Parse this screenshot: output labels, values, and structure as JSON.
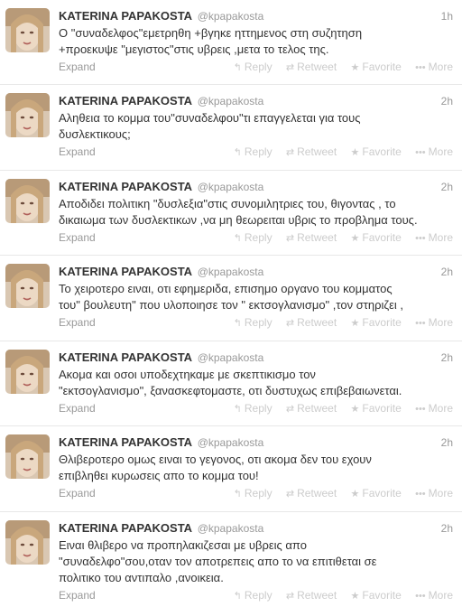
{
  "colors": {
    "name": "#333333",
    "muted": "#999999",
    "action": "#cccccc",
    "divider": "#e8e8e8"
  },
  "tweets": [
    {
      "fullname": "KATERINA PAPAKOSTA",
      "username": "@kpapakosta",
      "time": "1h",
      "lines": [
        "Ο  \"συναδελφος\"εμετρηθη +βγηκε ηττημενος στη συζητηση",
        "+προεκυψε \"μεγιστος\"στις  υβρεις ,μετα το τελος της."
      ],
      "expand": "Expand"
    },
    {
      "fullname": "KATERINA PAPAKOSTA",
      "username": "@kpapakosta",
      "time": "2h",
      "lines": [
        "Αληθεια το κομμα του\"συναδελφου\"τι επαγγελεται για τους",
        "δυσλεκτικους;"
      ],
      "expand": "Expand"
    },
    {
      "fullname": "KATERINA PAPAKOSTA",
      "username": "@kpapakosta",
      "time": "2h",
      "lines": [
        "Αποδιδει πολιτικη \"δυσλεξια\"στις συνομιλητριες  του, θιγοντας  , το",
        "δικαιωμα των δυσλεκτικων ,να μη θεωρειται υβρις το προβλημα  τους."
      ],
      "expand": "Expand"
    },
    {
      "fullname": "KATERINA PAPAKOSTA",
      "username": "@kpapakosta",
      "time": "2h",
      "lines": [
        "Το χειροτερο ειναι, οτι εφημεριδα,    επισημο οργανο του κομματος",
        "του\" βουλευτη\" που υλοποιησε  τον   \"   εκτσογλανισμο\" ,τον στηριζει ,"
      ],
      "expand": "Expand"
    },
    {
      "fullname": "KATERINA PAPAKOSTA",
      "username": "@kpapakosta",
      "time": "2h",
      "lines": [
        "Ακομα και οσοι υποδεχτηκαμε με  σκεπτικισμο  τον",
        "\"εκτσογλανισμο\", ξανασκεφτομαστε, οτι δυστυχως επιβεβαιωνεται."
      ],
      "expand": "Expand"
    },
    {
      "fullname": "KATERINA PAPAKOSTA",
      "username": "@kpapakosta",
      "time": "2h",
      "lines": [
        "Θλιβεροτερο ομως ειναι το γεγονος, οτι ακομα δεν του εχουν",
        "επιβληθει κυρωσεις απο το κομμα του!"
      ],
      "expand": "Expand"
    },
    {
      "fullname": "KATERINA PAPAKOSTA",
      "username": "@kpapakosta",
      "time": "2h",
      "lines": [
        "Ειναι θλιβερο να προπηλακιζεσαι με υβρεις απο",
        "\"συναδελφο\"σου,οταν τον αποτρεπεις απο το να  επιτιθεται σε",
        "πολιτικο του αντιπαλο ,ανοικεια."
      ],
      "expand": "Expand"
    }
  ],
  "actions": {
    "reply": {
      "label": "Reply",
      "icon": "reply-icon",
      "glyph": "↰"
    },
    "retweet": {
      "label": "Retweet",
      "icon": "retweet-icon",
      "glyph": "⇄"
    },
    "favorite": {
      "label": "Favorite",
      "icon": "star-icon",
      "glyph": "★"
    },
    "more": {
      "label": "More",
      "icon": "more-dots-icon",
      "glyph": "•••"
    }
  }
}
